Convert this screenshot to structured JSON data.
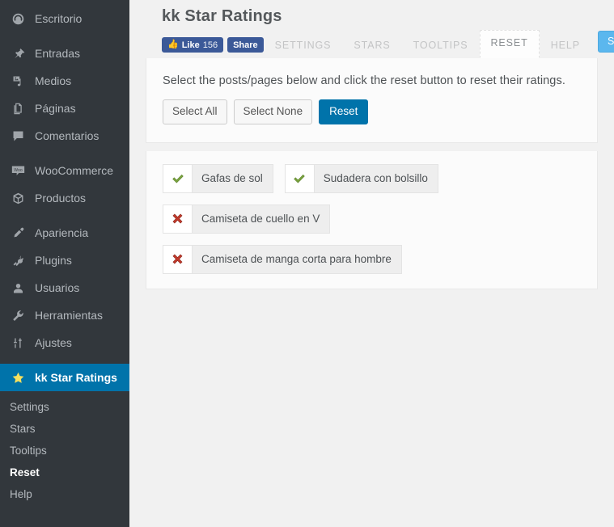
{
  "sidebar": {
    "items": [
      {
        "label": "Escritorio",
        "icon": "dashboard-icon",
        "sep_after": true
      },
      {
        "label": "Entradas",
        "icon": "pin-icon",
        "sep_after": false
      },
      {
        "label": "Medios",
        "icon": "media-icon",
        "sep_after": false
      },
      {
        "label": "Páginas",
        "icon": "pages-icon",
        "sep_after": false
      },
      {
        "label": "Comentarios",
        "icon": "comments-icon",
        "sep_after": true
      },
      {
        "label": "WooCommerce",
        "icon": "woocommerce-icon",
        "sep_after": false
      },
      {
        "label": "Productos",
        "icon": "products-icon",
        "sep_after": true
      },
      {
        "label": "Apariencia",
        "icon": "appearance-icon",
        "sep_after": false
      },
      {
        "label": "Plugins",
        "icon": "plugins-icon",
        "sep_after": false
      },
      {
        "label": "Usuarios",
        "icon": "users-icon",
        "sep_after": false
      },
      {
        "label": "Herramientas",
        "icon": "tools-icon",
        "sep_after": false
      },
      {
        "label": "Ajustes",
        "icon": "settings-icon",
        "sep_after": true
      }
    ],
    "active_item": {
      "label": "kk Star Ratings",
      "icon": "star-icon"
    },
    "submenu": [
      {
        "label": "Settings",
        "current": false
      },
      {
        "label": "Stars",
        "current": false
      },
      {
        "label": "Tooltips",
        "current": false
      },
      {
        "label": "Reset",
        "current": true
      },
      {
        "label": "Help",
        "current": false
      }
    ],
    "colors": {
      "background": "#32373c",
      "active_background": "#0073aa",
      "star": "#f6e05e"
    }
  },
  "header": {
    "title": "kk Star Ratings",
    "social": {
      "like_label": "Like",
      "like_count": "156",
      "share_label": "Share",
      "thumb_icon": "thumbs-up-icon",
      "color": "#3b5998"
    },
    "tabs": [
      {
        "label": "SETTINGS",
        "active": false
      },
      {
        "label": "STARS",
        "active": false
      },
      {
        "label": "TOOLTIPS",
        "active": false
      },
      {
        "label": "RESET",
        "active": true
      },
      {
        "label": "HELP",
        "active": false
      }
    ],
    "save_label": "SAVE",
    "save_color": "#5bb7ee"
  },
  "main": {
    "description": "Select the posts/pages below and click the reset button to reset their ratings.",
    "buttons": {
      "select_all": "Select All",
      "select_none": "Select None",
      "reset": "Reset"
    },
    "reset_color": "#0073aa",
    "rows": [
      [
        {
          "label": "Gafas de sol",
          "checked": true,
          "icon": "check-icon"
        },
        {
          "label": "Sudadera con bolsillo",
          "checked": true,
          "icon": "check-icon"
        }
      ],
      [
        {
          "label": "Camiseta de cuello en V",
          "checked": false,
          "icon": "cross-icon"
        }
      ],
      [
        {
          "label": "Camiseta de manga corta para hombre",
          "checked": false,
          "icon": "cross-icon"
        }
      ]
    ],
    "check_color": "#7aa33e",
    "cross_color": "#c0392b"
  }
}
